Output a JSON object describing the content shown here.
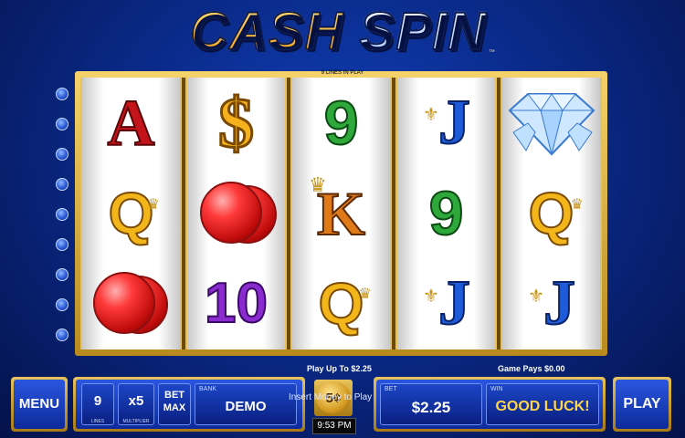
{
  "title": {
    "word1": "CASH",
    "word2": "SPIN",
    "trademark": "™"
  },
  "lines_in_play": "9 LINES IN PLAY",
  "reels": [
    [
      "A",
      "Q",
      "ruby"
    ],
    [
      "$",
      "ruby",
      "10"
    ],
    [
      "9",
      "K",
      "Q"
    ],
    [
      "J",
      "9",
      "J"
    ],
    [
      "diamond",
      "Q",
      "J"
    ]
  ],
  "symbols": {
    "A": "A",
    "Q": "Q",
    "J": "J",
    "K": "K",
    "9": "9",
    "10": "10",
    "$": "$"
  },
  "info": {
    "play_up_to": "Play Up To $2.25",
    "game_pays": "Game Pays $0.00",
    "insert_money": "Insert Money to Play"
  },
  "controls": {
    "menu_label": "MENU",
    "lines_value": "9",
    "lines_caption": "LINES",
    "multiplier_value": "x5",
    "multiplier_caption": "MULTIPLIER",
    "bet_max_line1": "BET",
    "bet_max_line2": "MAX",
    "bank_caption": "BANK",
    "bank_value": "DEMO",
    "coin_value": "5¢",
    "time": "9:53 PM",
    "bet_caption": "BET",
    "bet_value": "$2.25",
    "win_caption": "WIN",
    "win_value": "GOOD LUCK!",
    "play_label": "PLAY"
  },
  "colors": {
    "background": "#0a2a8a",
    "frame_gold": "#d4a93a",
    "panel_blue": "#1c46c8"
  }
}
